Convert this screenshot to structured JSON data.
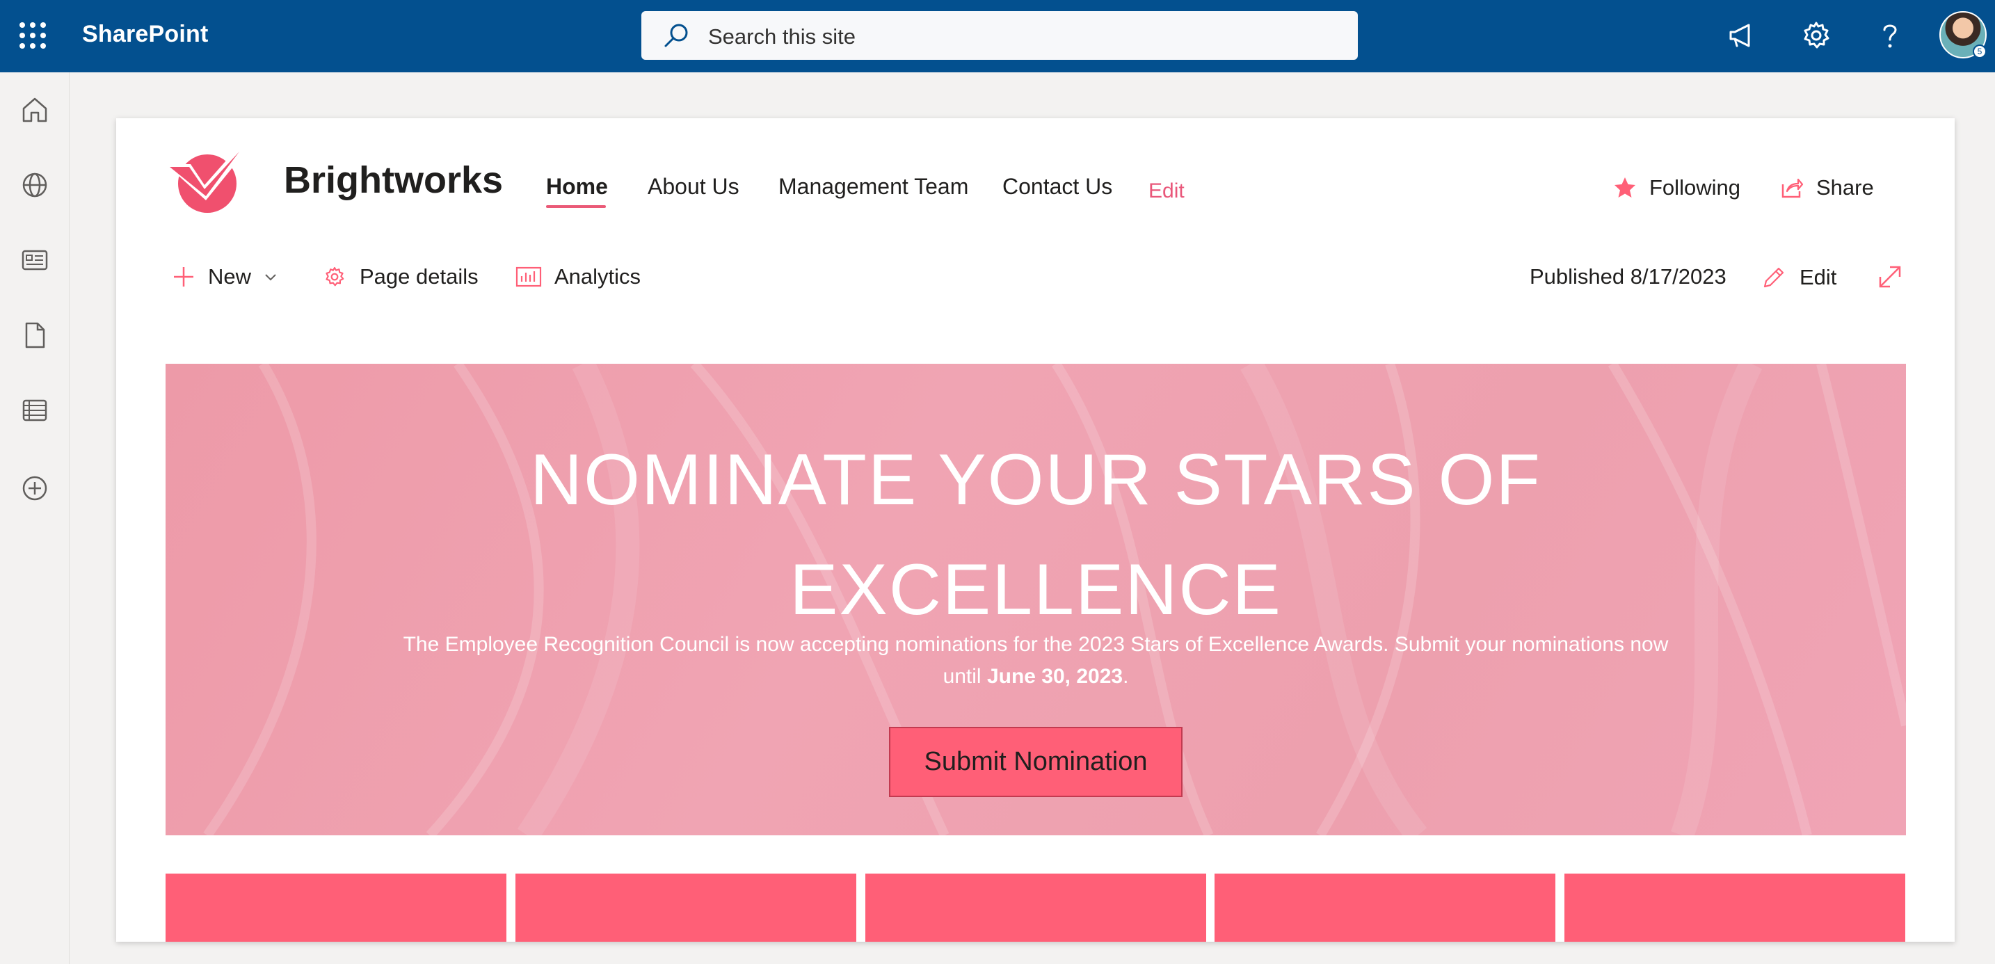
{
  "suite": {
    "app_name": "SharePoint",
    "search_placeholder": "Search this site",
    "avatar_badge": "5"
  },
  "site": {
    "title": "Brightworks",
    "nav": [
      "Home",
      "About Us",
      "Management Team",
      "Contact Us"
    ],
    "nav_edit": "Edit",
    "following_label": "Following",
    "share_label": "Share"
  },
  "commandbar": {
    "new_label": "New",
    "page_details_label": "Page details",
    "analytics_label": "Analytics",
    "published": "Published 8/17/2023",
    "edit_label": "Edit"
  },
  "hero": {
    "title_line1": "NOMINATE YOUR STARS OF",
    "title_line2": "EXCELLENCE",
    "body_text": "The Employee Recognition Council is now accepting nominations for the 2023 Stars of Excellence Awards. Submit your nominations now until",
    "body_date": "June 30, 2023",
    "body_end": ".",
    "button_label": "Submit Nomination"
  },
  "colors": {
    "suite_bar": "#03508f",
    "accent": "#ff5f77",
    "hero_bg": "#f0a4b3"
  }
}
